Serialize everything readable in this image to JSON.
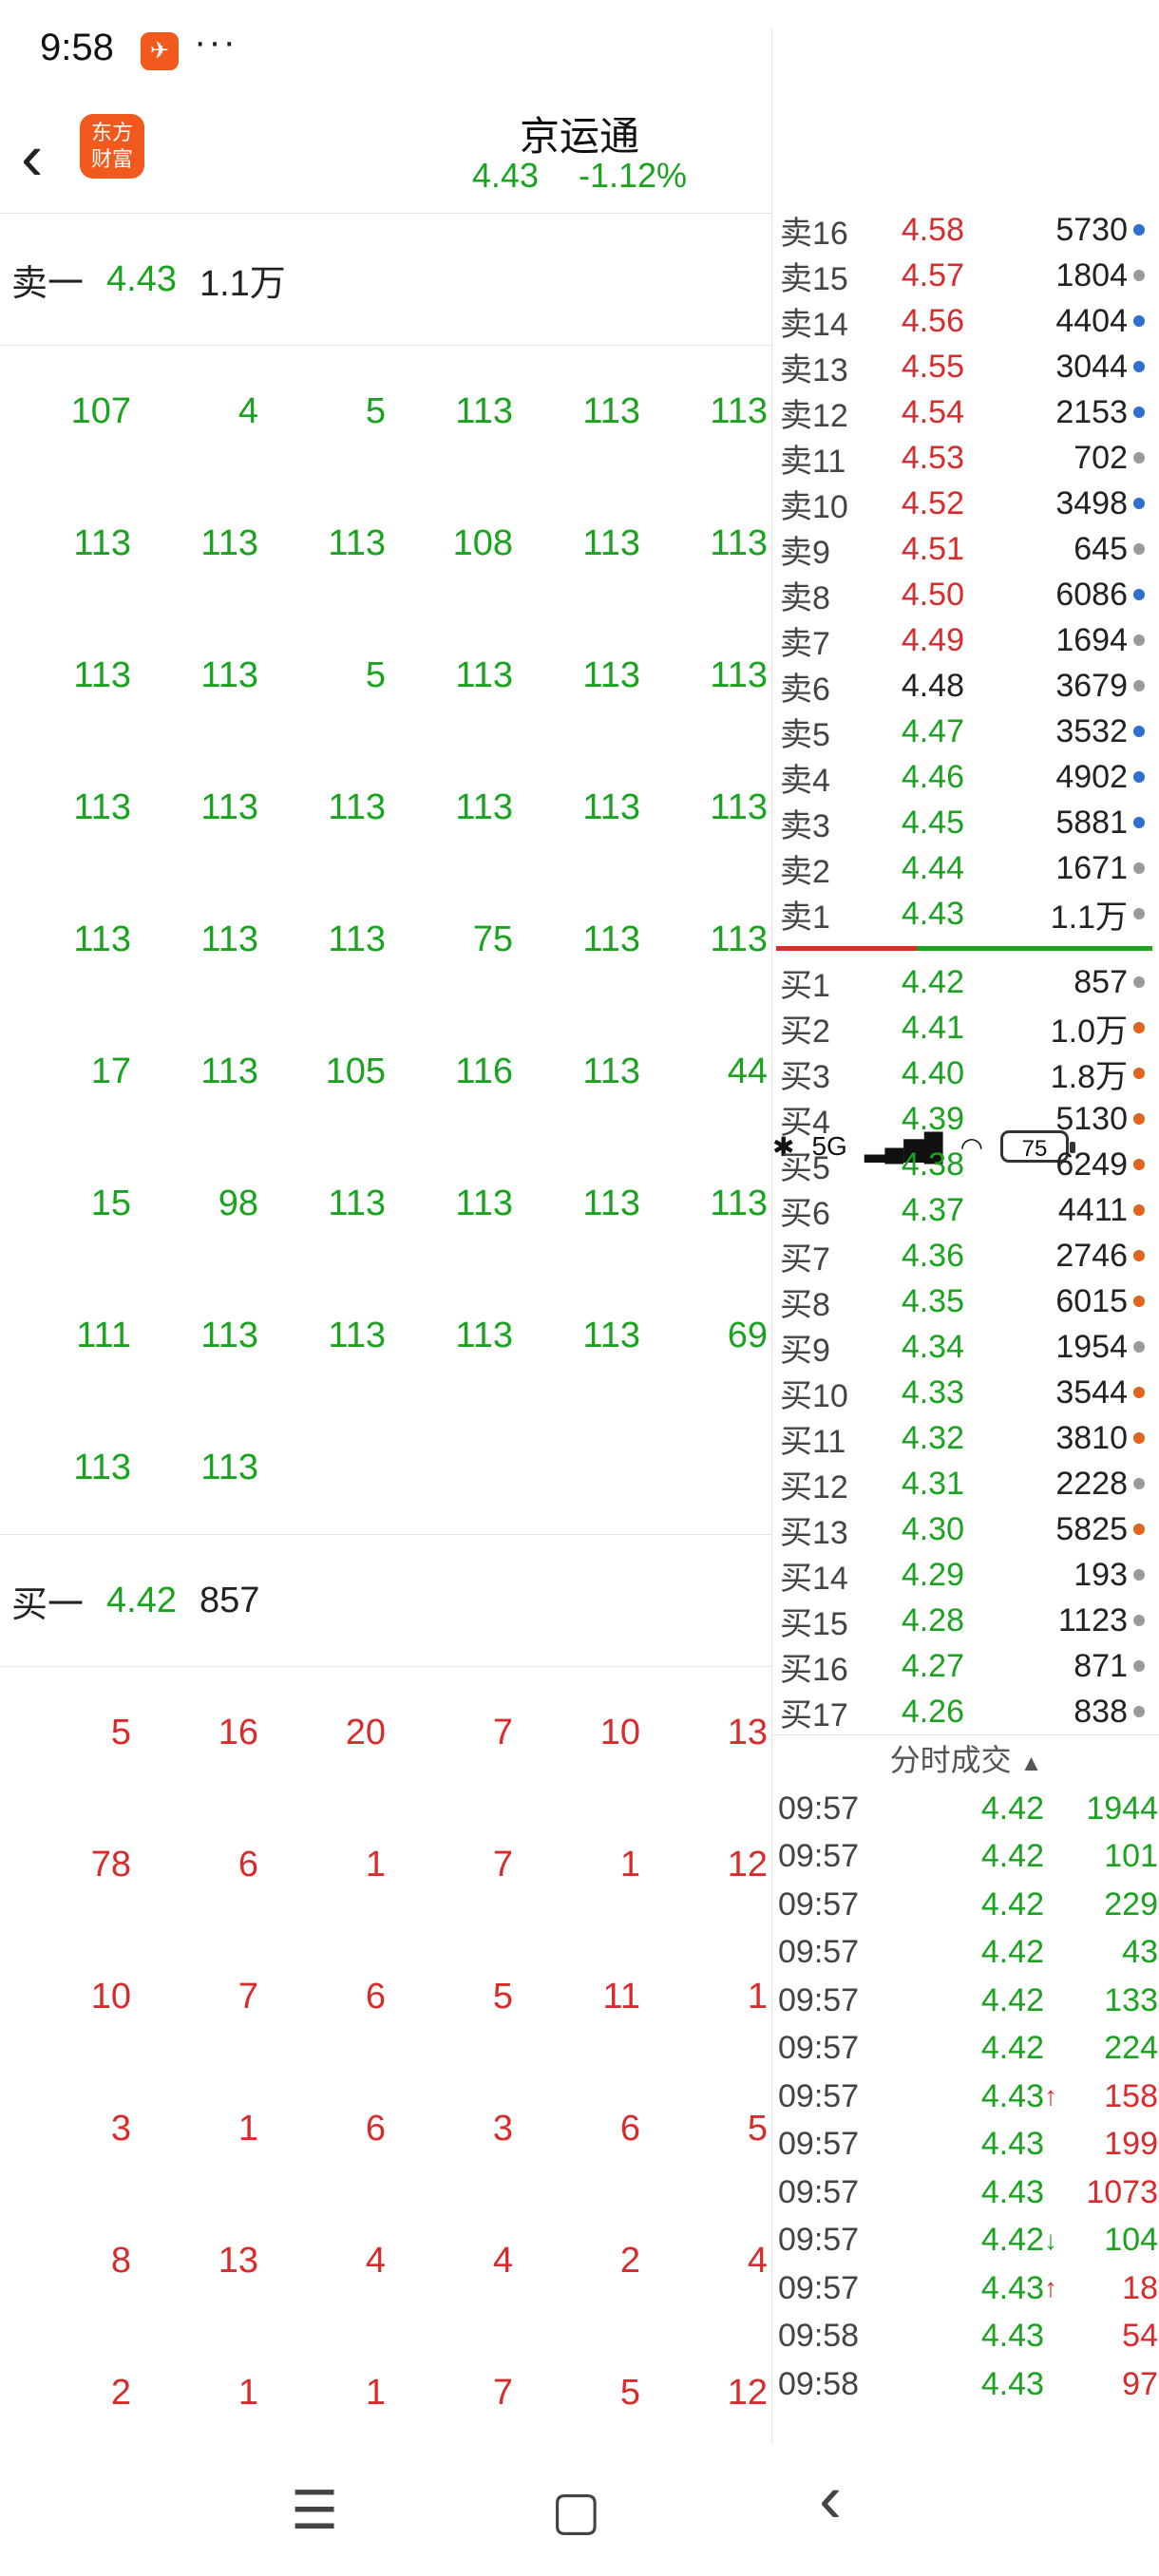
{
  "status": {
    "time": "9:58",
    "more": "···",
    "bt": "✱",
    "net": "5G",
    "signal": "▂▄▆█",
    "wifi": "◠",
    "battery": "75"
  },
  "header": {
    "back": "‹",
    "logo_line1": "东方",
    "logo_line2": "财富",
    "title": "京运通",
    "price": "4.43",
    "change": "-1.12%"
  },
  "sell_level": {
    "label": "卖一",
    "price": "4.43",
    "volume": "1.1万"
  },
  "sell_queue": [
    "107",
    "4",
    "5",
    "113",
    "113",
    "113",
    "113",
    "113",
    "113",
    "108",
    "113",
    "113",
    "113",
    "113",
    "5",
    "113",
    "113",
    "113",
    "113",
    "113",
    "113",
    "113",
    "113",
    "113",
    "113",
    "113",
    "113",
    "75",
    "113",
    "113",
    "17",
    "113",
    "105",
    "116",
    "113",
    "44",
    "15",
    "98",
    "113",
    "113",
    "113",
    "113",
    "111",
    "113",
    "113",
    "113",
    "113",
    "69",
    "113",
    "113"
  ],
  "buy_level": {
    "label": "买一",
    "price": "4.42",
    "volume": "857"
  },
  "buy_queue": [
    "5",
    "16",
    "20",
    "7",
    "10",
    "13",
    "78",
    "6",
    "1",
    "7",
    "1",
    "12",
    "10",
    "7",
    "6",
    "5",
    "11",
    "1",
    "3",
    "1",
    "6",
    "3",
    "6",
    "5",
    "8",
    "13",
    "4",
    "4",
    "2",
    "4",
    "2",
    "1",
    "1",
    "7",
    "5",
    "12"
  ],
  "order_book": {
    "asks": [
      {
        "label": "卖16",
        "price": "4.58",
        "vol": "5730",
        "dot": "blue",
        "pc": "red"
      },
      {
        "label": "卖15",
        "price": "4.57",
        "vol": "1804",
        "dot": "gray",
        "pc": "red"
      },
      {
        "label": "卖14",
        "price": "4.56",
        "vol": "4404",
        "dot": "blue",
        "pc": "red"
      },
      {
        "label": "卖13",
        "price": "4.55",
        "vol": "3044",
        "dot": "blue",
        "pc": "red"
      },
      {
        "label": "卖12",
        "price": "4.54",
        "vol": "2153",
        "dot": "blue",
        "pc": "red"
      },
      {
        "label": "卖11",
        "price": "4.53",
        "vol": "702",
        "dot": "gray",
        "pc": "red"
      },
      {
        "label": "卖10",
        "price": "4.52",
        "vol": "3498",
        "dot": "blue",
        "pc": "red"
      },
      {
        "label": "卖9",
        "price": "4.51",
        "vol": "645",
        "dot": "gray",
        "pc": "red"
      },
      {
        "label": "卖8",
        "price": "4.50",
        "vol": "6086",
        "dot": "blue",
        "pc": "red"
      },
      {
        "label": "卖7",
        "price": "4.49",
        "vol": "1694",
        "dot": "gray",
        "pc": "red"
      },
      {
        "label": "卖6",
        "price": "4.48",
        "vol": "3679",
        "dot": "gray",
        "pc": "black"
      },
      {
        "label": "卖5",
        "price": "4.47",
        "vol": "3532",
        "dot": "blue",
        "pc": "green"
      },
      {
        "label": "卖4",
        "price": "4.46",
        "vol": "4902",
        "dot": "blue",
        "pc": "green"
      },
      {
        "label": "卖3",
        "price": "4.45",
        "vol": "5881",
        "dot": "blue",
        "pc": "green"
      },
      {
        "label": "卖2",
        "price": "4.44",
        "vol": "1671",
        "dot": "gray",
        "pc": "green"
      },
      {
        "label": "卖1",
        "price": "4.43",
        "vol": "1.1万",
        "dot": "gray",
        "pc": "green"
      }
    ],
    "bids": [
      {
        "label": "买1",
        "price": "4.42",
        "vol": "857",
        "dot": "gray",
        "pc": "green"
      },
      {
        "label": "买2",
        "price": "4.41",
        "vol": "1.0万",
        "dot": "orange",
        "pc": "green"
      },
      {
        "label": "买3",
        "price": "4.40",
        "vol": "1.8万",
        "dot": "orange",
        "pc": "green"
      },
      {
        "label": "买4",
        "price": "4.39",
        "vol": "5130",
        "dot": "orange",
        "pc": "green"
      },
      {
        "label": "买5",
        "price": "4.38",
        "vol": "6249",
        "dot": "orange",
        "pc": "green"
      },
      {
        "label": "买6",
        "price": "4.37",
        "vol": "4411",
        "dot": "orange",
        "pc": "green"
      },
      {
        "label": "买7",
        "price": "4.36",
        "vol": "2746",
        "dot": "orange",
        "pc": "green"
      },
      {
        "label": "买8",
        "price": "4.35",
        "vol": "6015",
        "dot": "orange",
        "pc": "green"
      },
      {
        "label": "买9",
        "price": "4.34",
        "vol": "1954",
        "dot": "gray",
        "pc": "green"
      },
      {
        "label": "买10",
        "price": "4.33",
        "vol": "3544",
        "dot": "orange",
        "pc": "green"
      },
      {
        "label": "买11",
        "price": "4.32",
        "vol": "3810",
        "dot": "orange",
        "pc": "green"
      },
      {
        "label": "买12",
        "price": "4.31",
        "vol": "2228",
        "dot": "gray",
        "pc": "green"
      },
      {
        "label": "买13",
        "price": "4.30",
        "vol": "5825",
        "dot": "orange",
        "pc": "green"
      },
      {
        "label": "买14",
        "price": "4.29",
        "vol": "193",
        "dot": "gray",
        "pc": "green"
      },
      {
        "label": "买15",
        "price": "4.28",
        "vol": "1123",
        "dot": "gray",
        "pc": "green"
      },
      {
        "label": "买16",
        "price": "4.27",
        "vol": "871",
        "dot": "gray",
        "pc": "green"
      },
      {
        "label": "买17",
        "price": "4.26",
        "vol": "838",
        "dot": "gray",
        "pc": "green"
      }
    ]
  },
  "ticks_header": {
    "label": "分时成交",
    "arrow": "▲"
  },
  "ticks": [
    {
      "time": "09:57",
      "price": "4.42",
      "arrow": "",
      "vol": "1944",
      "vc": "green"
    },
    {
      "time": "09:57",
      "price": "4.42",
      "arrow": "",
      "vol": "101",
      "vc": "green"
    },
    {
      "time": "09:57",
      "price": "4.42",
      "arrow": "",
      "vol": "229",
      "vc": "green"
    },
    {
      "time": "09:57",
      "price": "4.42",
      "arrow": "",
      "vol": "43",
      "vc": "green"
    },
    {
      "time": "09:57",
      "price": "4.42",
      "arrow": "",
      "vol": "133",
      "vc": "green"
    },
    {
      "time": "09:57",
      "price": "4.42",
      "arrow": "",
      "vol": "224",
      "vc": "green"
    },
    {
      "time": "09:57",
      "price": "4.43",
      "arrow": "↑",
      "vol": "158",
      "vc": "red"
    },
    {
      "time": "09:57",
      "price": "4.43",
      "arrow": "",
      "vol": "199",
      "vc": "red"
    },
    {
      "time": "09:57",
      "price": "4.43",
      "arrow": "",
      "vol": "1073",
      "vc": "red"
    },
    {
      "time": "09:57",
      "price": "4.42",
      "arrow": "↓",
      "vol": "104",
      "vc": "green"
    },
    {
      "time": "09:57",
      "price": "4.43",
      "arrow": "↑",
      "vol": "18",
      "vc": "red"
    },
    {
      "time": "09:58",
      "price": "4.43",
      "arrow": "",
      "vol": "54",
      "vc": "red"
    },
    {
      "time": "09:58",
      "price": "4.43",
      "arrow": "",
      "vol": "97",
      "vc": "red"
    }
  ],
  "nav": {
    "menu": "☰",
    "home": "▢",
    "back": "‹"
  },
  "colors": {
    "green": "#19a31e",
    "red": "#d92b2b",
    "blue": "#2e6fd1",
    "gray": "#9a9a9a",
    "orange": "#e0651b",
    "black": "#222222"
  }
}
